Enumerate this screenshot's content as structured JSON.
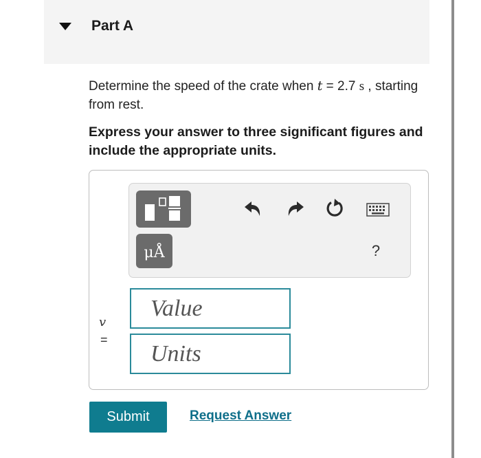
{
  "part": {
    "title": "Part A"
  },
  "question": {
    "text_before": "Determine the speed of the crate when ",
    "variable": "t",
    "equals": " = 2.7 ",
    "unit": "s",
    "text_after": " , starting from rest."
  },
  "instruction": "Express your answer to three significant figures and include the appropriate units.",
  "toolbar": {
    "templates_icon": "templates-icon",
    "units_label": "μÅ",
    "undo_icon": "undo-arrow-icon",
    "redo_icon": "redo-arrow-icon",
    "reset_icon": "reset-circular-arrow-icon",
    "keyboard_icon": "keyboard-icon",
    "help_label": "?"
  },
  "answer": {
    "variable": "v",
    "equals": "=",
    "value_placeholder": "Value",
    "units_placeholder": "Units"
  },
  "actions": {
    "submit_label": "Submit",
    "request_answer_label": "Request Answer"
  },
  "colors": {
    "accent": "#0f7c8f",
    "field_border": "#2a8a9a",
    "link": "#0f6f8a",
    "tool_button": "#6b6b6b"
  }
}
